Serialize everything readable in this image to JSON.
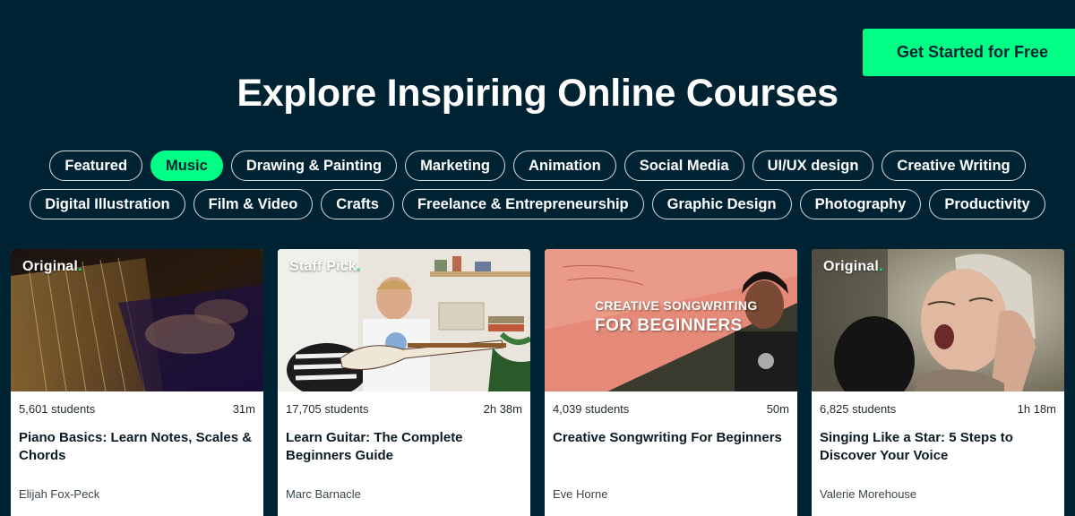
{
  "header": {
    "cta_label": "Get Started for Free",
    "title": "Explore Inspiring Online Courses"
  },
  "categories": {
    "row1": [
      "Featured",
      "Music",
      "Drawing & Painting",
      "Marketing",
      "Animation",
      "Social Media",
      "UI/UX design",
      "Creative Writing"
    ],
    "row2": [
      "Digital Illustration",
      "Film & Video",
      "Crafts",
      "Freelance & Entrepreneurship",
      "Graphic Design",
      "Photography",
      "Productivity"
    ],
    "active": "Music"
  },
  "courses": [
    {
      "badge": "Original",
      "students": "5,601 students",
      "duration": "31m",
      "title": "Piano Basics: Learn Notes, Scales & Chords",
      "teacher": "Elijah Fox-Peck"
    },
    {
      "badge": "Staff Pick",
      "students": "17,705 students",
      "duration": "2h 38m",
      "title": "Learn Guitar: The Complete Beginners Guide",
      "teacher": "Marc Barnacle"
    },
    {
      "badge": "",
      "thumb_text_1": "CREATIVE SONGWRITING",
      "thumb_text_2": "FOR BEGINNERS",
      "students": "4,039 students",
      "duration": "50m",
      "title": "Creative Songwriting For Beginners",
      "teacher": "Eve Horne"
    },
    {
      "badge": "Original",
      "students": "6,825 students",
      "duration": "1h 18m",
      "title": "Singing Like a Star: 5 Steps to Discover Your Voice",
      "teacher": "Valerie Morehouse"
    }
  ],
  "colors": {
    "background": "#002333",
    "accent": "#00ff84",
    "card": "#ffffff"
  }
}
